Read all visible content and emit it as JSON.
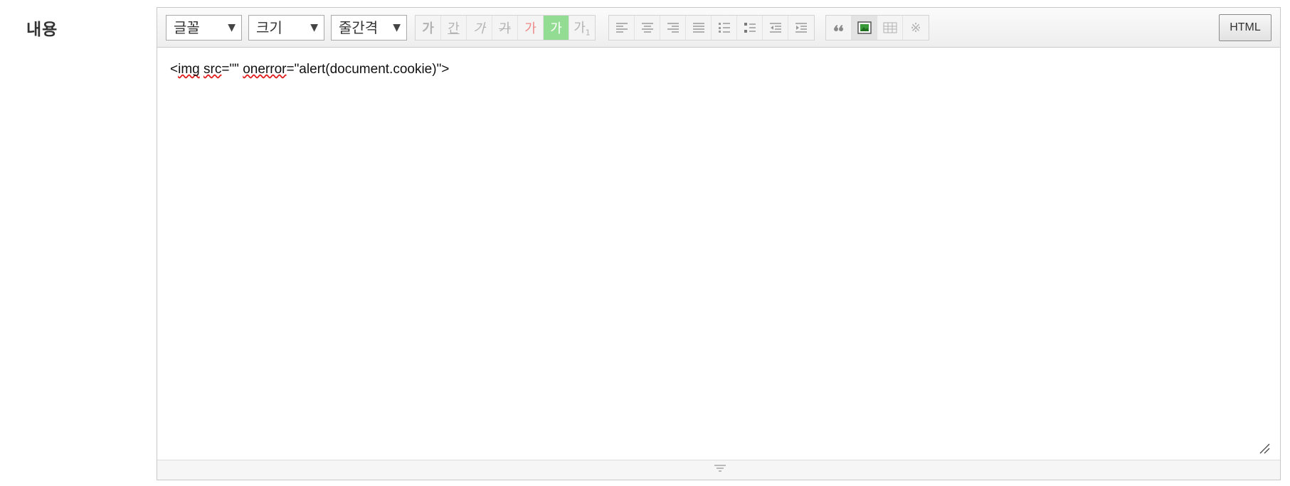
{
  "field": {
    "label": "내용"
  },
  "toolbar": {
    "font_select": "글꼴",
    "size_select": "크기",
    "lineheight_select": "줄간격",
    "format_buttons": [
      "가",
      "간",
      "가",
      "가",
      "가",
      "가",
      "가"
    ],
    "html_button": "HTML"
  },
  "editor": {
    "content_parts": [
      "<",
      "img",
      " ",
      "src",
      "=\"\" ",
      "onerror",
      "=\"alert(document.cookie)\">"
    ]
  },
  "colors": {
    "font_color_icon": "#ee8888",
    "bg_color_icon": "#93dc93",
    "spellcheck_underline": "#e02020"
  }
}
